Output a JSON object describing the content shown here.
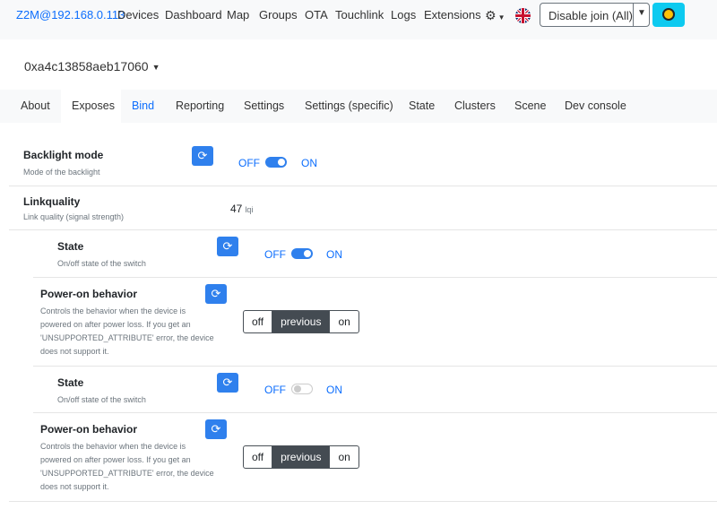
{
  "navbar": {
    "brand": "Z2M@192.168.0.113",
    "items": [
      "Devices",
      "Dashboard",
      "Map",
      "Groups",
      "OTA",
      "Touchlink",
      "Logs",
      "Extensions"
    ],
    "settings_icon": "gear-icon",
    "language_icon": "uk-flag-icon",
    "join_button": "Disable join (All)",
    "theme_icon": "sun-icon"
  },
  "device": {
    "title": "0xa4c13858aeb17060"
  },
  "tabs": [
    "About",
    "Exposes",
    "Bind",
    "Reporting",
    "Settings",
    "Settings (specific)",
    "State",
    "Clusters",
    "Scene",
    "Dev console"
  ],
  "active_tab": "Exposes",
  "exposes": {
    "backlight": {
      "title": "Backlight mode",
      "desc": "Mode of the backlight",
      "off": "OFF",
      "on": "ON",
      "state": "on"
    },
    "linkquality": {
      "title": "Linkquality",
      "desc": "Link quality (signal strength)",
      "value": "47",
      "unit": "lqi"
    },
    "state1": {
      "title": "State",
      "desc": "On/off state of the switch",
      "off": "OFF",
      "on": "ON",
      "state": "on"
    },
    "power1": {
      "title": "Power-on behavior",
      "desc_lines": [
        "Controls the behavior when the device is",
        "powered on after power loss. If you get an",
        "'UNSUPPORTED_ATTRIBUTE' error, the device",
        "does not support it."
      ],
      "options": [
        "off",
        "previous",
        "on"
      ],
      "selected": "previous"
    },
    "state2": {
      "title": "State",
      "desc": "On/off state of the switch",
      "off": "OFF",
      "on": "ON",
      "state": "off"
    },
    "power2": {
      "title": "Power-on behavior",
      "desc_lines": [
        "Controls the behavior when the device is",
        "powered on after power loss. If you get an",
        "'UNSUPPORTED_ATTRIBUTE' error, the device",
        "does not support it."
      ],
      "options": [
        "off",
        "previous",
        "on"
      ],
      "selected": "previous"
    }
  }
}
